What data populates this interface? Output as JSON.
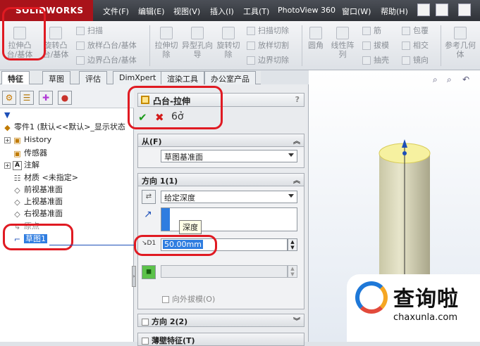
{
  "app": {
    "logo": "SOLIDWORKS"
  },
  "menu": [
    "文件(F)",
    "编辑(E)",
    "视图(V)",
    "插入(I)",
    "工具(T)",
    "PhotoView 360",
    "窗口(W)",
    "帮助(H)"
  ],
  "ribbon": {
    "extrude_boss": "拉伸凸台/基体",
    "revolve_boss": "旋转凸台/基体",
    "sweep": "扫描",
    "loft": "放样凸台/基体",
    "boundary_boss": "边界凸台/基体",
    "extrude_cut": "拉伸切除",
    "hole_wizard": "异型孔向导",
    "revolve_cut": "旋转切除",
    "swept_cut": "扫描切除",
    "lofted_cut": "放样切割",
    "boundary_cut": "边界切除",
    "fillet": "圆角",
    "linear_pattern": "线性阵列",
    "rib": "筋",
    "draft": "拔模",
    "shell": "抽壳",
    "wrap": "包覆",
    "intersect": "相交",
    "mirror": "镜向",
    "ref_geometry": "参考几何体"
  },
  "tabs": [
    "特征",
    "草图",
    "评估",
    "DimXpert",
    "渲染工具",
    "办公室产品"
  ],
  "tree": {
    "part": "零件1 (默认<<默认>_显示状态",
    "items": [
      "History",
      "传感器",
      "注解",
      "材质 <未指定>",
      "前视基准面",
      "上视基准面",
      "右视基准面",
      "原点",
      "草图1"
    ]
  },
  "property_manager": {
    "title": "凸台-拉伸",
    "help": "?",
    "from_label": "从(F)",
    "from_value": "草图基准面",
    "dir1_label": "方向 1(1)",
    "end_condition": "给定深度",
    "tooltip": "深度",
    "depth_value": "50.00mm",
    "draft_outward": "向外拔模(O)",
    "dir2_label": "方向 2(2)",
    "thin_feature": "薄壁特征(T)"
  },
  "watermark": {
    "brand": "查询啦",
    "url": "chaxunla.com"
  },
  "colors": {
    "annotation_red": "#e01a22",
    "brand_red": "#a9131a",
    "depth_highlight": "#2f7de0"
  }
}
